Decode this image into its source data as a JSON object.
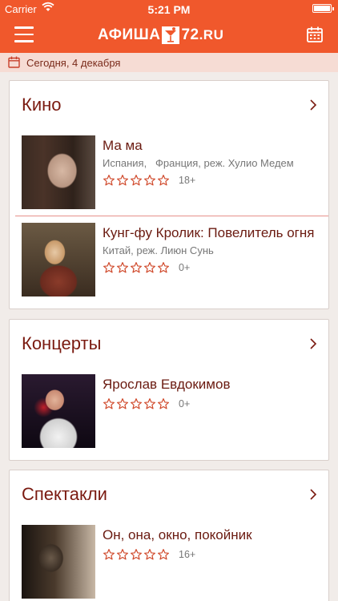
{
  "status_bar": {
    "carrier": "Carrier",
    "time": "5:21 PM"
  },
  "header": {
    "logo_left": "АФИША",
    "logo_right": "72",
    "logo_domain": ".RU",
    "bg_color": "#f0582c"
  },
  "date_bar": {
    "label": "Сегодня, 4 декабря"
  },
  "sections": [
    {
      "title": "Кино",
      "items": [
        {
          "name": "Ма ма",
          "meta": "Испания,   Франция, реж. Хулио Медем",
          "age": "18+",
          "rating": 0
        },
        {
          "name": "Кунг-фу Кролик: Повелитель огня",
          "meta": "Китай, реж. Лиюн Сунь",
          "age": "0+",
          "rating": 0
        }
      ]
    },
    {
      "title": "Концерты",
      "items": [
        {
          "name": "Ярослав Евдокимов",
          "meta": "",
          "age": "0+",
          "rating": 0
        }
      ]
    },
    {
      "title": "Спектакли",
      "items": [
        {
          "name": "Он, она, окно, покойник",
          "meta": "",
          "age": "16+",
          "rating": 0
        }
      ]
    }
  ]
}
